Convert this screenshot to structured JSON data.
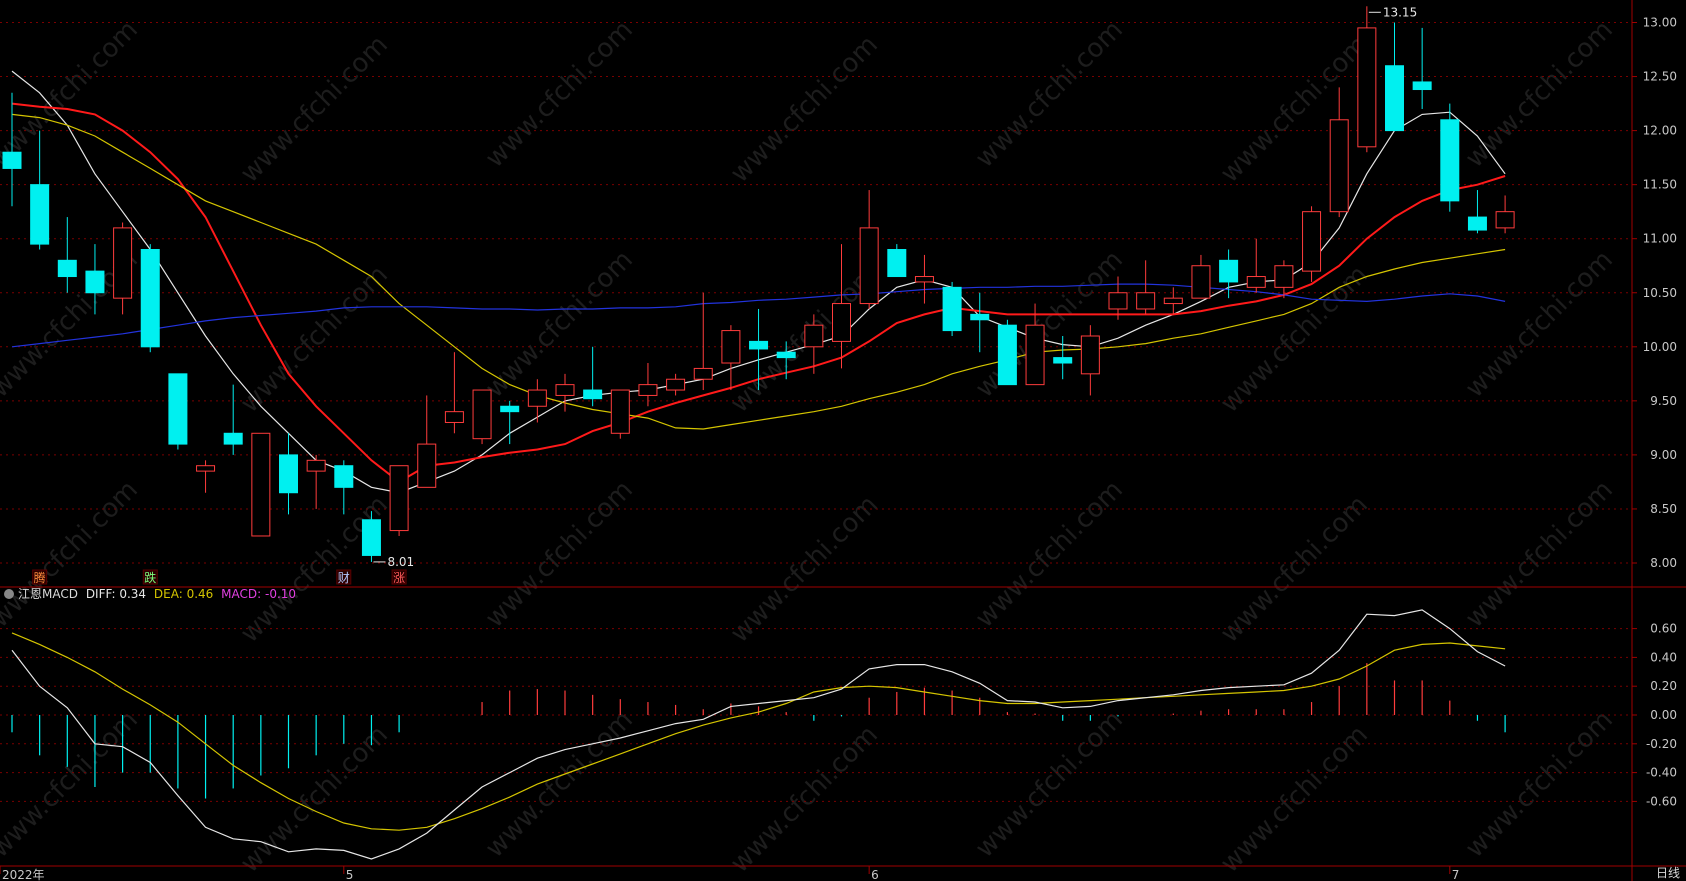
{
  "indicator": {
    "name": "江恩MACD",
    "diff_label": "DIFF:",
    "diff_value": "0.34",
    "dea_label": "DEA:",
    "dea_value": "0.46",
    "macd_label": "MACD:",
    "macd_value": "-0.10"
  },
  "period_label": "日线",
  "watermark": "www.cfchi.com",
  "colors": {
    "background": "#000000",
    "up": "#ff3c3c",
    "down": "#00f0f0",
    "ma_white": "#e6e6e6",
    "ma_red": "#ff1a1a",
    "ma_yellow": "#d4c400",
    "ma_blue": "#2233dd",
    "diff": "#e6e6e6",
    "dea": "#d4c400",
    "grid": "#7a0000",
    "axis": "#a00000"
  },
  "chart_data": [
    {
      "type": "candlestick",
      "name": "price",
      "y_ticks": [
        "8.00",
        "8.50",
        "9.00",
        "9.50",
        "10.00",
        "10.50",
        "11.00",
        "11.50",
        "12.00",
        "12.50",
        "13.00"
      ],
      "ylim": [
        7.8,
        13.2
      ],
      "x_ticks": [
        {
          "label": "2022年",
          "index": 0
        },
        {
          "label": "5",
          "index": 12
        },
        {
          "label": "6",
          "index": 31
        },
        {
          "label": "7",
          "index": 52
        }
      ],
      "annotations": [
        {
          "text": "13.15",
          "index": 49,
          "value": 13.15
        },
        {
          "text": "8.01",
          "index": 13,
          "value": 8.01
        }
      ],
      "event_markers": [
        {
          "text": "腾",
          "index": 1,
          "color": "#ff8c3c"
        },
        {
          "text": "跌",
          "index": 5,
          "color": "#7dff7d"
        },
        {
          "text": "财",
          "index": 12,
          "color": "#b4c8ff"
        },
        {
          "text": "涨",
          "index": 14,
          "color": "#ff5a5a"
        }
      ],
      "candles": [
        {
          "o": 11.8,
          "h": 12.35,
          "l": 11.3,
          "c": 11.65
        },
        {
          "o": 11.5,
          "h": 12.0,
          "l": 10.9,
          "c": 10.95
        },
        {
          "o": 10.8,
          "h": 11.2,
          "l": 10.5,
          "c": 10.65
        },
        {
          "o": 10.7,
          "h": 10.95,
          "l": 10.3,
          "c": 10.5
        },
        {
          "o": 10.45,
          "h": 11.15,
          "l": 10.3,
          "c": 11.1
        },
        {
          "o": 10.9,
          "h": 10.95,
          "l": 9.95,
          "c": 10.0
        },
        {
          "o": 9.75,
          "h": 9.75,
          "l": 9.05,
          "c": 9.1
        },
        {
          "o": 8.85,
          "h": 8.95,
          "l": 8.65,
          "c": 8.9
        },
        {
          "o": 9.2,
          "h": 9.65,
          "l": 9.0,
          "c": 9.1
        },
        {
          "o": 8.25,
          "h": 9.2,
          "l": 8.25,
          "c": 9.2
        },
        {
          "o": 9.0,
          "h": 9.2,
          "l": 8.45,
          "c": 8.65
        },
        {
          "o": 8.85,
          "h": 9.0,
          "l": 8.5,
          "c": 8.95
        },
        {
          "o": 8.9,
          "h": 8.95,
          "l": 8.45,
          "c": 8.7
        },
        {
          "o": 8.4,
          "h": 8.48,
          "l": 8.01,
          "c": 8.07
        },
        {
          "o": 8.3,
          "h": 8.9,
          "l": 8.25,
          "c": 8.9
        },
        {
          "o": 8.7,
          "h": 9.55,
          "l": 8.7,
          "c": 9.1
        },
        {
          "o": 9.3,
          "h": 9.95,
          "l": 9.2,
          "c": 9.4
        },
        {
          "o": 9.15,
          "h": 9.6,
          "l": 9.1,
          "c": 9.6
        },
        {
          "o": 9.45,
          "h": 9.5,
          "l": 9.1,
          "c": 9.4
        },
        {
          "o": 9.45,
          "h": 9.7,
          "l": 9.3,
          "c": 9.6
        },
        {
          "o": 9.55,
          "h": 9.75,
          "l": 9.4,
          "c": 9.65
        },
        {
          "o": 9.6,
          "h": 10.0,
          "l": 9.45,
          "c": 9.52
        },
        {
          "o": 9.2,
          "h": 9.55,
          "l": 9.15,
          "c": 9.6
        },
        {
          "o": 9.55,
          "h": 9.85,
          "l": 9.45,
          "c": 9.65
        },
        {
          "o": 9.6,
          "h": 9.75,
          "l": 9.55,
          "c": 9.7
        },
        {
          "o": 9.7,
          "h": 10.5,
          "l": 9.6,
          "c": 9.8
        },
        {
          "o": 9.85,
          "h": 10.2,
          "l": 9.6,
          "c": 10.15
        },
        {
          "o": 10.05,
          "h": 10.35,
          "l": 9.6,
          "c": 9.98
        },
        {
          "o": 9.95,
          "h": 10.05,
          "l": 9.7,
          "c": 9.9
        },
        {
          "o": 10.0,
          "h": 10.3,
          "l": 9.75,
          "c": 10.2
        },
        {
          "o": 10.05,
          "h": 10.95,
          "l": 9.8,
          "c": 10.4
        },
        {
          "o": 10.4,
          "h": 11.45,
          "l": 10.35,
          "c": 11.1
        },
        {
          "o": 10.9,
          "h": 10.95,
          "l": 10.65,
          "c": 10.65
        },
        {
          "o": 10.6,
          "h": 10.85,
          "l": 10.4,
          "c": 10.65
        },
        {
          "o": 10.55,
          "h": 10.6,
          "l": 10.1,
          "c": 10.15
        },
        {
          "o": 10.3,
          "h": 10.5,
          "l": 9.95,
          "c": 10.25
        },
        {
          "o": 10.2,
          "h": 10.25,
          "l": 9.65,
          "c": 9.65
        },
        {
          "o": 9.65,
          "h": 10.4,
          "l": 9.65,
          "c": 10.2
        },
        {
          "o": 9.9,
          "h": 10.1,
          "l": 9.7,
          "c": 9.85
        },
        {
          "o": 9.75,
          "h": 10.2,
          "l": 9.55,
          "c": 10.1
        },
        {
          "o": 10.35,
          "h": 10.65,
          "l": 10.25,
          "c": 10.5
        },
        {
          "o": 10.35,
          "h": 10.8,
          "l": 10.3,
          "c": 10.5
        },
        {
          "o": 10.4,
          "h": 10.55,
          "l": 10.3,
          "c": 10.45
        },
        {
          "o": 10.45,
          "h": 10.85,
          "l": 10.45,
          "c": 10.75
        },
        {
          "o": 10.8,
          "h": 10.9,
          "l": 10.45,
          "c": 10.6
        },
        {
          "o": 10.55,
          "h": 11.0,
          "l": 10.5,
          "c": 10.65
        },
        {
          "o": 10.55,
          "h": 10.8,
          "l": 10.45,
          "c": 10.75
        },
        {
          "o": 10.7,
          "h": 11.3,
          "l": 10.6,
          "c": 11.25
        },
        {
          "o": 11.25,
          "h": 12.4,
          "l": 11.2,
          "c": 12.1
        },
        {
          "o": 11.85,
          "h": 13.15,
          "l": 11.8,
          "c": 12.95
        },
        {
          "o": 12.6,
          "h": 13.0,
          "l": 12.0,
          "c": 12.0
        },
        {
          "o": 12.45,
          "h": 12.95,
          "l": 12.2,
          "c": 12.38
        },
        {
          "o": 12.1,
          "h": 12.25,
          "l": 11.25,
          "c": 11.35
        },
        {
          "o": 11.2,
          "h": 11.45,
          "l": 11.05,
          "c": 11.08
        },
        {
          "o": 11.1,
          "h": 11.4,
          "l": 11.05,
          "c": 11.25
        }
      ],
      "ma_series": [
        {
          "name": "MA5",
          "color": "#e6e6e6",
          "values": [
            12.55,
            12.35,
            12.05,
            11.6,
            11.25,
            10.9,
            10.5,
            10.1,
            9.75,
            9.45,
            9.2,
            8.95,
            8.85,
            8.7,
            8.65,
            8.75,
            8.85,
            9.0,
            9.2,
            9.35,
            9.5,
            9.55,
            9.58,
            9.6,
            9.65,
            9.7,
            9.8,
            9.88,
            9.95,
            10.02,
            10.1,
            10.35,
            10.55,
            10.62,
            10.55,
            10.28,
            10.18,
            10.08,
            10.02,
            10.0,
            10.08,
            10.2,
            10.3,
            10.42,
            10.55,
            10.6,
            10.62,
            10.78,
            11.1,
            11.6,
            12.0,
            12.15,
            12.17,
            11.95,
            11.6
          ]
        },
        {
          "name": "MA10",
          "color": "#ff1a1a",
          "values": [
            12.25,
            12.22,
            12.2,
            12.15,
            12.0,
            11.8,
            11.55,
            11.2,
            10.7,
            10.2,
            9.75,
            9.45,
            9.2,
            8.95,
            8.75,
            8.9,
            8.93,
            8.98,
            9.02,
            9.05,
            9.1,
            9.22,
            9.3,
            9.4,
            9.48,
            9.55,
            9.62,
            9.7,
            9.76,
            9.82,
            9.9,
            10.05,
            10.22,
            10.3,
            10.36,
            10.33,
            10.3,
            10.3,
            10.3,
            10.3,
            10.3,
            10.3,
            10.3,
            10.33,
            10.38,
            10.42,
            10.48,
            10.58,
            10.75,
            11.0,
            11.2,
            11.35,
            11.45,
            11.5,
            11.58
          ]
        },
        {
          "name": "MA20",
          "color": "#d4c400",
          "values": [
            12.15,
            12.12,
            12.05,
            11.95,
            11.8,
            11.65,
            11.5,
            11.35,
            11.25,
            11.15,
            11.05,
            10.95,
            10.8,
            10.65,
            10.4,
            10.2,
            10.0,
            9.8,
            9.65,
            9.55,
            9.48,
            9.42,
            9.38,
            9.34,
            9.25,
            9.24,
            9.28,
            9.32,
            9.36,
            9.4,
            9.45,
            9.52,
            9.58,
            9.65,
            9.75,
            9.82,
            9.88,
            9.95,
            9.97,
            9.98,
            10.0,
            10.03,
            10.08,
            10.12,
            10.18,
            10.24,
            10.3,
            10.4,
            10.55,
            10.65,
            10.72,
            10.78,
            10.82,
            10.86,
            10.9
          ]
        },
        {
          "name": "MA60",
          "color": "#2233dd",
          "values": [
            10.0,
            10.03,
            10.06,
            10.09,
            10.12,
            10.16,
            10.2,
            10.24,
            10.27,
            10.29,
            10.31,
            10.33,
            10.36,
            10.37,
            10.37,
            10.37,
            10.36,
            10.35,
            10.35,
            10.34,
            10.35,
            10.35,
            10.36,
            10.36,
            10.37,
            10.4,
            10.41,
            10.43,
            10.44,
            10.46,
            10.48,
            10.49,
            10.51,
            10.53,
            10.54,
            10.55,
            10.55,
            10.56,
            10.56,
            10.57,
            10.58,
            10.58,
            10.57,
            10.55,
            10.53,
            10.51,
            10.48,
            10.44,
            10.43,
            10.42,
            10.44,
            10.47,
            10.49,
            10.47,
            10.42
          ]
        }
      ]
    },
    {
      "type": "macd",
      "name": "江恩MACD",
      "y_ticks": [
        "-0.60",
        "-0.40",
        "-0.20",
        "0.00",
        "0.20",
        "0.40",
        "0.60"
      ],
      "ylim": [
        -1.05,
        0.85
      ],
      "diff": [
        0.45,
        0.2,
        0.05,
        -0.2,
        -0.22,
        -0.33,
        -0.56,
        -0.78,
        -0.86,
        -0.88,
        -0.95,
        -0.93,
        -0.94,
        -1.0,
        -0.93,
        -0.82,
        -0.66,
        -0.5,
        -0.4,
        -0.3,
        -0.24,
        -0.2,
        -0.16,
        -0.11,
        -0.06,
        -0.03,
        0.06,
        0.08,
        0.1,
        0.12,
        0.18,
        0.32,
        0.35,
        0.35,
        0.3,
        0.22,
        0.1,
        0.09,
        0.05,
        0.06,
        0.1,
        0.12,
        0.14,
        0.17,
        0.19,
        0.2,
        0.21,
        0.29,
        0.45,
        0.7,
        0.69,
        0.73,
        0.6,
        0.44,
        0.34
      ],
      "dea": [
        0.57,
        0.49,
        0.4,
        0.3,
        0.18,
        0.07,
        -0.05,
        -0.2,
        -0.35,
        -0.47,
        -0.58,
        -0.67,
        -0.75,
        -0.79,
        -0.8,
        -0.78,
        -0.72,
        -0.65,
        -0.57,
        -0.48,
        -0.41,
        -0.34,
        -0.27,
        -0.2,
        -0.13,
        -0.07,
        -0.02,
        0.02,
        0.08,
        0.16,
        0.19,
        0.2,
        0.19,
        0.16,
        0.13,
        0.1,
        0.08,
        0.08,
        0.09,
        0.1,
        0.11,
        0.12,
        0.13,
        0.14,
        0.15,
        0.16,
        0.17,
        0.2,
        0.25,
        0.34,
        0.45,
        0.49,
        0.5,
        0.48,
        0.46
      ],
      "hist": [
        -0.12,
        -0.28,
        -0.36,
        -0.5,
        -0.4,
        -0.4,
        -0.51,
        -0.58,
        -0.51,
        -0.42,
        -0.37,
        -0.28,
        -0.2,
        -0.21,
        -0.12,
        0,
        0,
        0.09,
        0.17,
        0.18,
        0.17,
        0.14,
        0.11,
        0.09,
        0.07,
        0.04,
        0.08,
        0.06,
        0.02,
        -0.04,
        -0.01,
        0.12,
        0.16,
        0.19,
        0.17,
        0.12,
        0.02,
        0.01,
        -0.04,
        -0.04,
        -0.01,
        0.0,
        0.01,
        0.03,
        0.04,
        0.04,
        0.04,
        0.09,
        0.2,
        0.36,
        0.24,
        0.24,
        0.1,
        -0.04,
        -0.12
      ]
    }
  ]
}
